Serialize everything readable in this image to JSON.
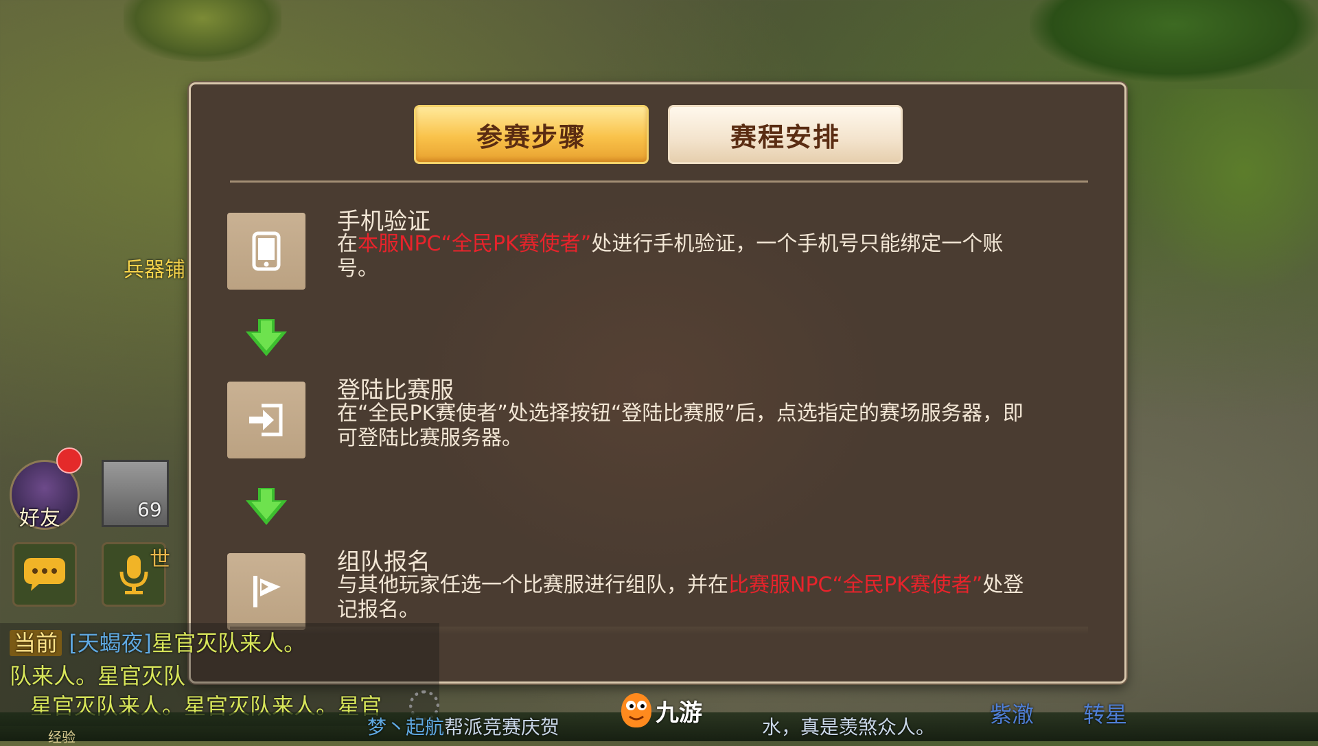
{
  "tabs": {
    "active_label": "参赛步骤",
    "inactive_label": "赛程安排"
  },
  "steps": [
    {
      "icon": "phone-icon",
      "title": "手机验证",
      "desc_pre": "在",
      "desc_red": "本服NPC“全民PK赛使者”",
      "desc_post": "处进行手机验证，一个手机号只能绑定一个账号。"
    },
    {
      "icon": "login-icon",
      "title": "登陆比赛服",
      "desc": "在“全民PK赛使者”处选择按钮“登陆比赛服”后，点选指定的赛场服务器，即可登陆比赛服务器。"
    },
    {
      "icon": "flag-icon",
      "title": "组队报名",
      "desc_pre": "与其他玩家任选一个比赛服进行组队，并在",
      "desc_red": "比赛服NPC“全民PK赛使者”",
      "desc_post": "处登记报名。"
    }
  ],
  "hud": {
    "friends_label": "好友",
    "level": "69",
    "shop_label": "兵器铺",
    "side_char": "世"
  },
  "chat": {
    "channel": "当前",
    "name": "[天蝎夜]",
    "line1_rest": "星官灭队来人。",
    "line2": "队来人。星官灭队",
    "line3": "星官灭队来人。星官灭队来人。星官",
    "xp_label": "经验"
  },
  "ticker": {
    "left_name": "梦丶起航",
    "left_text": "帮派竞赛庆贺",
    "right_text": "水，真是羡煞众人。"
  },
  "logo": {
    "text": "九游"
  },
  "right_names": {
    "name1": "紫澈",
    "name2": "转星"
  },
  "colors": {
    "panel_bg": "#4a3c31",
    "accent_red": "#e7232b",
    "tab_active": "#f9c24a",
    "tab_inactive": "#f3e3cc",
    "arrow_green": "#3dbf2f"
  }
}
